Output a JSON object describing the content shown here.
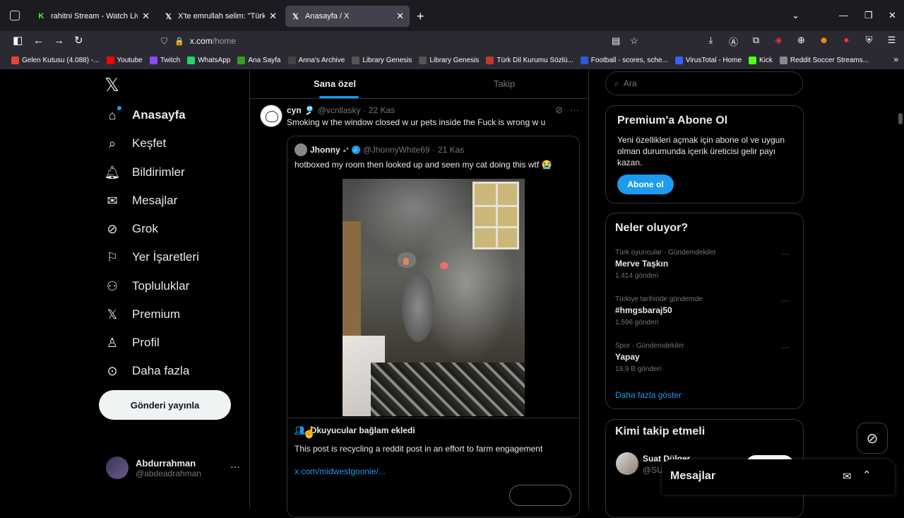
{
  "browser": {
    "tabs": [
      {
        "title": "rahitni Stream - Watch Live on K",
        "icon": "kick-icon"
      },
      {
        "title": "X'te emrullah selim: \"Türk şiirinin",
        "icon": "x-icon"
      },
      {
        "title": "Anasayfa / X",
        "icon": "x-icon"
      }
    ],
    "url_host": "x.com",
    "url_path": "/home",
    "bookmarks": [
      {
        "label": "Gelen Kutusu (4.088) -...",
        "icon": "gmail-icon",
        "color": "#ea4335"
      },
      {
        "label": "Youtube",
        "icon": "youtube-icon",
        "color": "#ff0000"
      },
      {
        "label": "Twitch",
        "icon": "twitch-icon",
        "color": "#9146ff"
      },
      {
        "label": "WhatsApp",
        "icon": "whatsapp-icon",
        "color": "#25d366"
      },
      {
        "label": "Ana Sayfa",
        "icon": "page-icon",
        "color": "#3a9d23"
      },
      {
        "label": "Anna's Archive",
        "icon": "anna-icon",
        "color": "#444444"
      },
      {
        "label": "Library Genesis",
        "icon": "book-icon",
        "color": "#555555"
      },
      {
        "label": "Library Genesis",
        "icon": "book-icon",
        "color": "#555555"
      },
      {
        "label": "Türk Dil Kurumu Sözlü...",
        "icon": "tdk-icon",
        "color": "#c0392b"
      },
      {
        "label": "Football - scores, sche...",
        "icon": "football-icon",
        "color": "#2a5bd7"
      },
      {
        "label": "VirusTotal - Home",
        "icon": "virustotal-icon",
        "color": "#3b61ff"
      },
      {
        "label": "Kick",
        "icon": "kick-icon",
        "color": "#53fc18"
      },
      {
        "label": "Reddit Soccer Streams...",
        "icon": "reddit-icon",
        "color": "#888888"
      }
    ]
  },
  "nav": {
    "items": [
      {
        "label": "Anasayfa",
        "icon": "home-icon"
      },
      {
        "label": "Keşfet",
        "icon": "search-icon"
      },
      {
        "label": "Bildirimler",
        "icon": "bell-icon"
      },
      {
        "label": "Mesajlar",
        "icon": "mail-icon"
      },
      {
        "label": "Grok",
        "icon": "grok-icon"
      },
      {
        "label": "Yer İşaretleri",
        "icon": "bookmark-icon"
      },
      {
        "label": "Topluluklar",
        "icon": "people-icon"
      },
      {
        "label": "Premium",
        "icon": "x-icon"
      },
      {
        "label": "Profil",
        "icon": "user-icon"
      },
      {
        "label": "Daha fazla",
        "icon": "more-circle-icon"
      }
    ],
    "post_button": "Gönderi yayınla",
    "profile_name": "Abdurrahman",
    "profile_handle": "@abdeadrahman"
  },
  "feed": {
    "tabs": [
      "Sana özel",
      "Takip"
    ],
    "tweet": {
      "name": "cyn",
      "emoji": "🎐",
      "handle": "@vcnllasky",
      "date": "· 22 Kas",
      "text": "Smoking w the window closed w ur pets inside the Fuck is wrong w u",
      "quote": {
        "name": "Jhonny",
        "stars": "⁎*",
        "handle": "@JhonnyWhite69",
        "date": "· 21 Kas",
        "text": "hotboxed my room then looked up and seen my cat doing this wtf 😭"
      },
      "context": {
        "title": "Okuyucular bağlam ekledi",
        "text": "This post is recycling a reddit post in an effort to farm engagement",
        "link": "x.com/midwestgoonie/..."
      }
    }
  },
  "right": {
    "search_placeholder": "Ara",
    "premium": {
      "title": "Premium'a Abone Ol",
      "text": "Yeni özellikleri açmak için abone ol ve uygun olman durumunda içerik üreticisi gelir payı kazan.",
      "button": "Abone ol"
    },
    "trends": {
      "title": "Neler oluyor?",
      "items": [
        {
          "category": "Türk oyuncular · Gündemdekiler",
          "name": "Merve Taşkın",
          "count": "1.414 gönderi"
        },
        {
          "category": "Türkiye tarihinde gündemde",
          "name": "#hmgsbaraj50",
          "count": "1.596 gönderi"
        },
        {
          "category": "Spor · Gündemdekiler",
          "name": "Yapay",
          "count": "19,9 B gönderi"
        }
      ],
      "more": "Daha fazla göster"
    },
    "follow": {
      "title": "Kimi takip etmeli",
      "name": "Suat Dülger",
      "handle": "@SU"
    }
  },
  "dm": {
    "title": "Mesajlar"
  },
  "colors": {
    "accent": "#1d9bf0",
    "background": "#000000",
    "border": "#2f3336",
    "muted_text": "#71767b"
  }
}
